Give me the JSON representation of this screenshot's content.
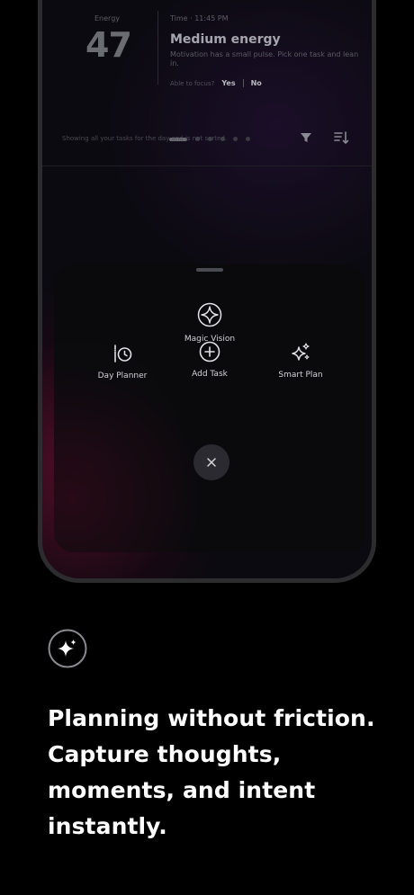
{
  "energy_card": {
    "energy_label": "Energy",
    "energy_value": "47",
    "time_label": "Time · 11:45 PM",
    "title": "Medium energy",
    "description": "Motivation has a small pulse. Pick one task and lean in.",
    "focus_question": "Able to focus?",
    "yes_label": "Yes",
    "no_label": "No",
    "pager_count": 6,
    "pager_active_index": 0
  },
  "task_filter": {
    "status_text": "Showing all your tasks for the day and is not sorted.",
    "filter_icon": "funnel-icon",
    "sort_icon": "sort-icon"
  },
  "action_sheet": {
    "primary": {
      "label": "Magic Vision",
      "icon": "magic-vision-icon"
    },
    "actions": [
      {
        "label": "Day Planner",
        "icon": "day-planner-icon"
      },
      {
        "label": "Add Task",
        "icon": "plus-circle-icon"
      },
      {
        "label": "Smart Plan",
        "icon": "sparkles-icon"
      }
    ],
    "close_icon": "close-icon"
  },
  "marketing": {
    "icon": "sparkle-badge-icon",
    "headline_lines": [
      "Planning without friction.",
      "Capture thoughts,",
      "moments, and intent",
      "instantly."
    ]
  },
  "colors": {
    "background": "#000000",
    "phone_frame": "#2c2c2e",
    "sheet": "#0a0a0e",
    "accent_glow": "#5f0e2a"
  }
}
